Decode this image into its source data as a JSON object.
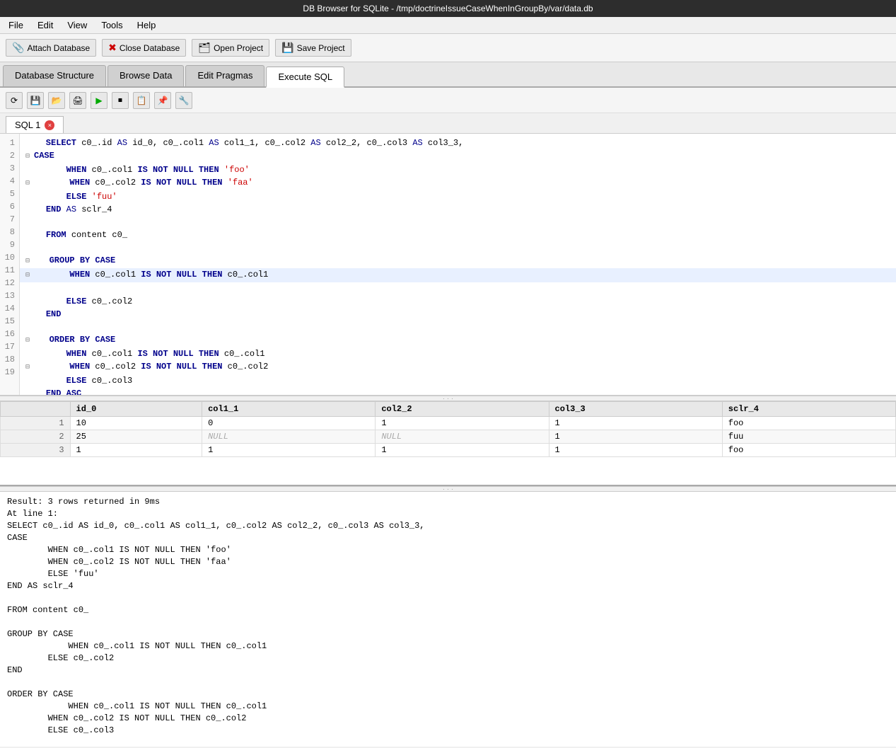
{
  "titleBar": {
    "text": "DB Browser for SQLite - /tmp/doctrineIssueCaseWhenInGroupBy/var/data.db"
  },
  "menuBar": {
    "items": [
      "File",
      "Edit",
      "View",
      "Tools",
      "Help"
    ]
  },
  "toolbar": {
    "buttons": [
      {
        "label": "Attach Database",
        "icon": "📎"
      },
      {
        "label": "Close Database",
        "icon": "✖"
      },
      {
        "label": "Open Project",
        "icon": "📂"
      },
      {
        "label": "Save Project",
        "icon": "💾"
      }
    ]
  },
  "tabs": [
    {
      "label": "Database Structure",
      "active": false
    },
    {
      "label": "Browse Data",
      "active": false
    },
    {
      "label": "Edit Pragmas",
      "active": false
    },
    {
      "label": "Execute SQL",
      "active": true
    }
  ],
  "sqlTab": {
    "label": "SQL 1",
    "closeIcon": "×"
  },
  "sqlToolbar": {
    "buttons": [
      {
        "icon": "⟳",
        "name": "refresh"
      },
      {
        "icon": "💾",
        "name": "save"
      },
      {
        "icon": "📂",
        "name": "open"
      },
      {
        "icon": "🖨",
        "name": "print"
      },
      {
        "icon": "▶",
        "name": "run"
      },
      {
        "icon": "⏹",
        "name": "stop"
      },
      {
        "icon": "📋",
        "name": "copy"
      },
      {
        "icon": "📌",
        "name": "paste"
      },
      {
        "icon": "🔧",
        "name": "tool"
      }
    ]
  },
  "sqlCode": {
    "lines": [
      {
        "num": 1,
        "text": "    SELECT c0_.id AS id_0, c0_.col1 AS col1_1, c0_.col2 AS col2_2, c0_.col3 AS col3_3,"
      },
      {
        "num": 2,
        "text": "⊟   CASE"
      },
      {
        "num": 3,
        "text": "        WHEN c0_.col1 IS NOT NULL THEN 'foo'"
      },
      {
        "num": 4,
        "text": "⊟      WHEN c0_.col2 IS NOT NULL THEN 'faa'"
      },
      {
        "num": 5,
        "text": "        ELSE 'fuu'"
      },
      {
        "num": 6,
        "text": "    END AS sclr_4"
      },
      {
        "num": 7,
        "text": ""
      },
      {
        "num": 8,
        "text": "    FROM content c0_"
      },
      {
        "num": 9,
        "text": ""
      },
      {
        "num": 10,
        "text": "⊟   GROUP BY CASE"
      },
      {
        "num": 11,
        "text": "⊟       WHEN c0_.col1 IS NOT NULL THEN c0_.col1",
        "highlight": true
      },
      {
        "num": 12,
        "text": "        ELSE c0_.col2"
      },
      {
        "num": 13,
        "text": "    END"
      },
      {
        "num": 14,
        "text": ""
      },
      {
        "num": 15,
        "text": "⊟   ORDER BY CASE"
      },
      {
        "num": 16,
        "text": "        WHEN c0_.col1 IS NOT NULL THEN c0_.col1"
      },
      {
        "num": 17,
        "text": "⊟       WHEN c0_.col2 IS NOT NULL THEN c0_.col2"
      },
      {
        "num": 18,
        "text": "        ELSE c0_.col3"
      },
      {
        "num": 19,
        "text": "    END ASC"
      }
    ]
  },
  "resultsTable": {
    "columns": [
      "",
      "id_0",
      "col1_1",
      "col2_2",
      "col3_3",
      "sclr_4"
    ],
    "rows": [
      {
        "rowNum": "1",
        "id_0": "10",
        "col1_1": "0",
        "col2_2": "1",
        "col3_3": "1",
        "sclr_4": "foo"
      },
      {
        "rowNum": "2",
        "id_0": "25",
        "col1_1": "NULL",
        "col2_2": "NULL",
        "col3_3": "1",
        "sclr_4": "fuu"
      },
      {
        "rowNum": "3",
        "id_0": "1",
        "col1_1": "1",
        "col2_2": "1",
        "col3_3": "1",
        "sclr_4": "foo"
      }
    ]
  },
  "logArea": {
    "text": "Result: 3 rows returned in 9ms\nAt line 1:\nSELECT c0_.id AS id_0, c0_.col1 AS col1_1, c0_.col2 AS col2_2, c0_.col3 AS col3_3,\nCASE\n\t\tWHEN c0_.col1 IS NOT NULL THEN 'foo'\n\t\tWHEN c0_.col2 IS NOT NULL THEN 'faa'\n\t\tELSE 'fuu'\nEND AS sclr_4\n\nFROM content c0_\n\nGROUP BY CASE\n\t\t\tWHEN c0_.col1 IS NOT NULL THEN c0_.col1\n\t\tELSE c0_.col2\nEND\n\nORDER BY CASE\n\t\t\tWHEN c0_.col1 IS NOT NULL THEN c0_.col1\n\t\tWHEN c0_.col2 IS NOT NULL THEN c0_.col2\n\t\tELSE c0_.col3"
  }
}
